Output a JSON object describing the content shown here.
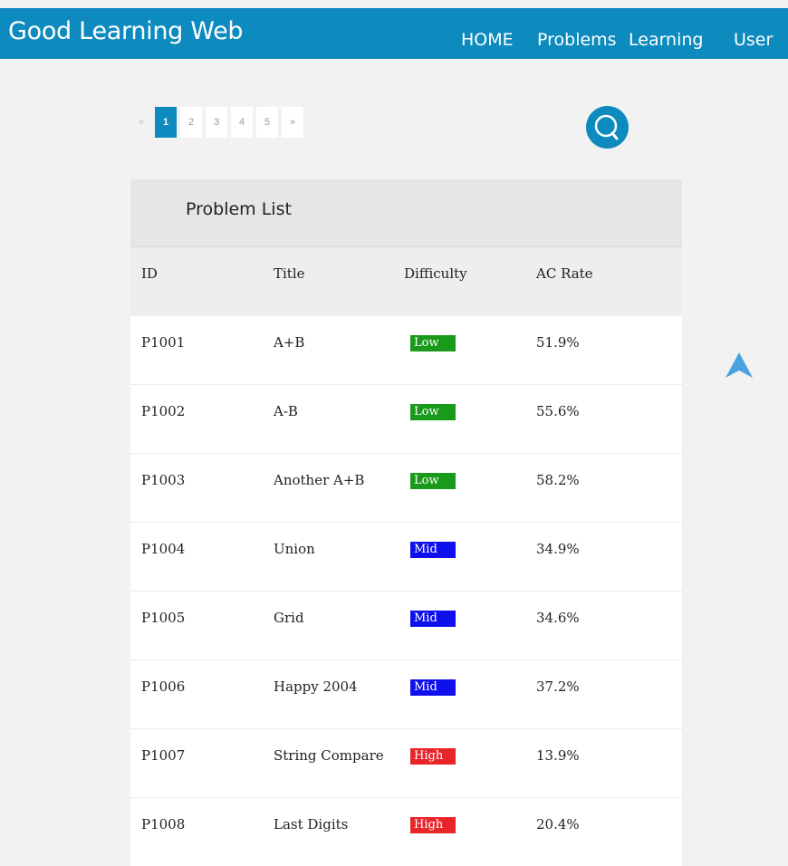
{
  "header": {
    "brand": "Good Learning Web",
    "nav": [
      "HOME",
      "Problems",
      "Learning",
      "User"
    ]
  },
  "pagination": {
    "prev": "«",
    "pages": [
      "1",
      "2",
      "3",
      "4",
      "5"
    ],
    "next": "»",
    "current": 1
  },
  "search": {
    "icon": "search-icon"
  },
  "panel": {
    "title": "Problem List",
    "columns": [
      "ID",
      "Title",
      "Difficulty",
      "AC Rate"
    ],
    "rows": [
      {
        "id": "P1001",
        "title": "A+B",
        "difficulty": "Low",
        "ac_rate": "51.9%"
      },
      {
        "id": "P1002",
        "title": "A-B",
        "difficulty": "Low",
        "ac_rate": "55.6%"
      },
      {
        "id": "P1003",
        "title": "Another A+B",
        "difficulty": "Low",
        "ac_rate": "58.2%"
      },
      {
        "id": "P1004",
        "title": "Union",
        "difficulty": "Mid",
        "ac_rate": "34.9%"
      },
      {
        "id": "P1005",
        "title": "Grid",
        "difficulty": "Mid",
        "ac_rate": "34.6%"
      },
      {
        "id": "P1006",
        "title": "Happy 2004",
        "difficulty": "Mid",
        "ac_rate": "37.2%"
      },
      {
        "id": "P1007",
        "title": "String Compare",
        "difficulty": "High",
        "ac_rate": "13.9%"
      },
      {
        "id": "P1008",
        "title": "Last Digits",
        "difficulty": "High",
        "ac_rate": "20.4%"
      }
    ]
  },
  "colors": {
    "primary": "#0d8abe",
    "low": "#1a9a1a",
    "mid": "#1010ee",
    "high": "#e8262a",
    "back_to_top": "#4aa3df"
  },
  "back_to_top": {
    "icon": "arrow-up-icon"
  }
}
